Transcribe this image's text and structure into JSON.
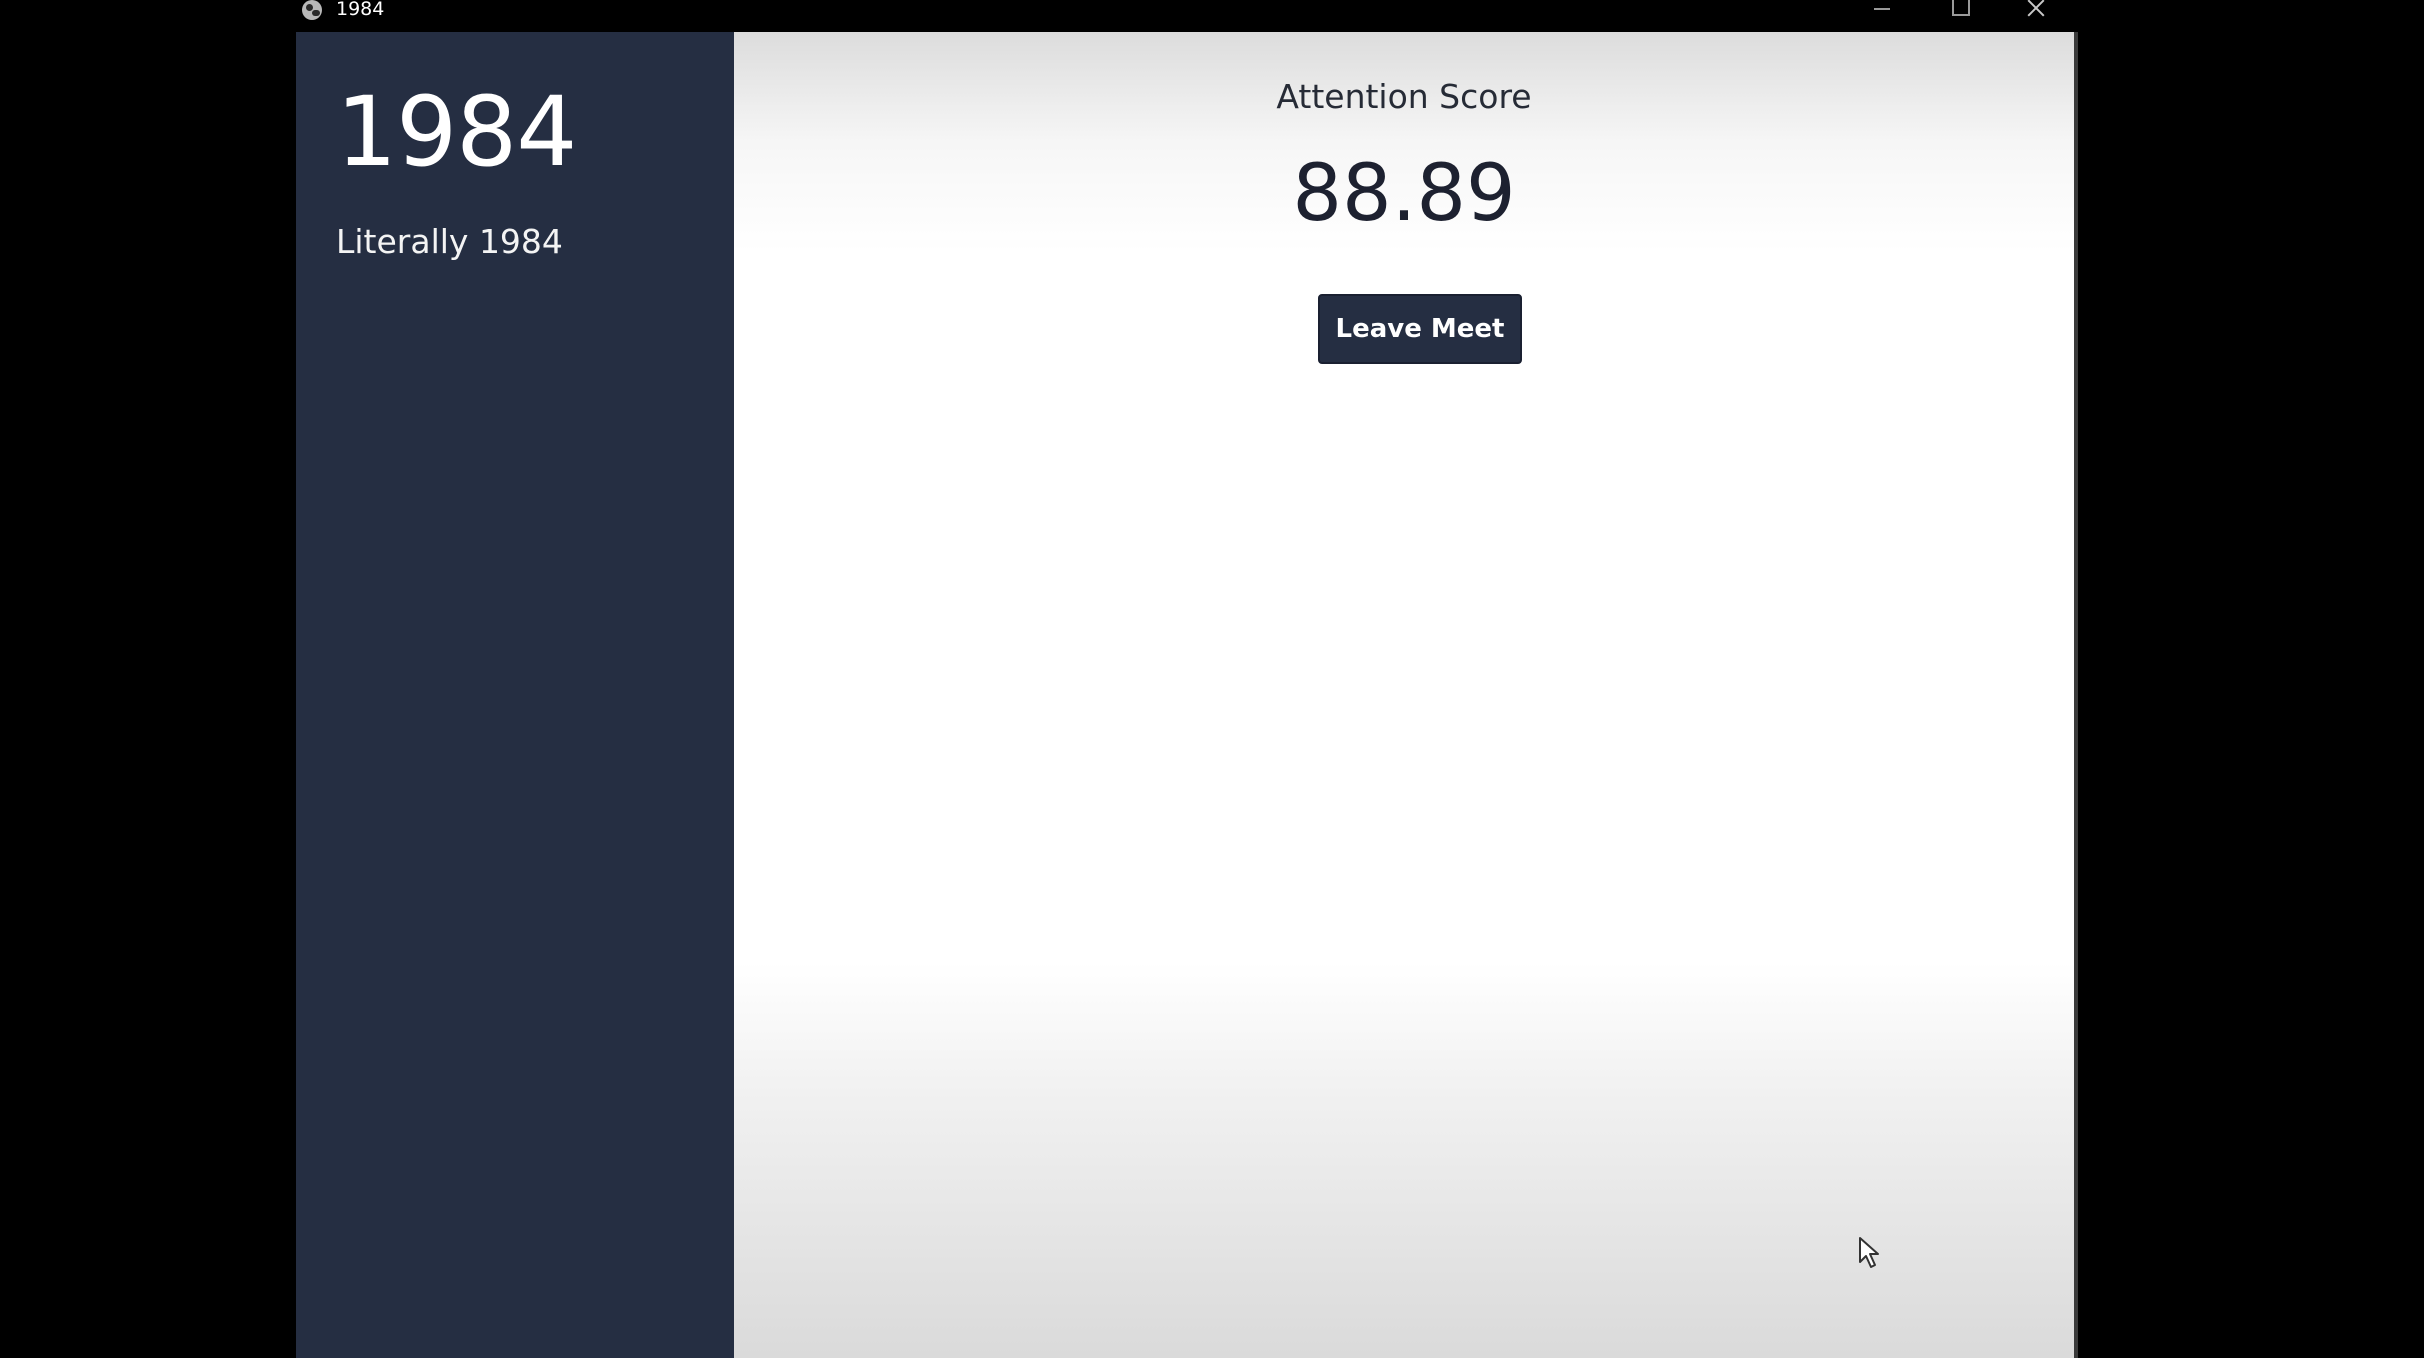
{
  "window": {
    "title": "1984",
    "icons": {
      "app": "globe-icon",
      "minimize": "minimize-icon",
      "maximize": "maximize-icon",
      "close": "close-icon"
    }
  },
  "sidebar": {
    "heading": "1984",
    "subtitle": "Literally 1984",
    "background_color": "#252e42"
  },
  "main": {
    "score_label": "Attention Score",
    "score_value": "88.89",
    "leave_button_label": "Leave Meet",
    "accent_color": "#252e42"
  },
  "pointer": {
    "icon": "mouse-cursor-icon"
  }
}
